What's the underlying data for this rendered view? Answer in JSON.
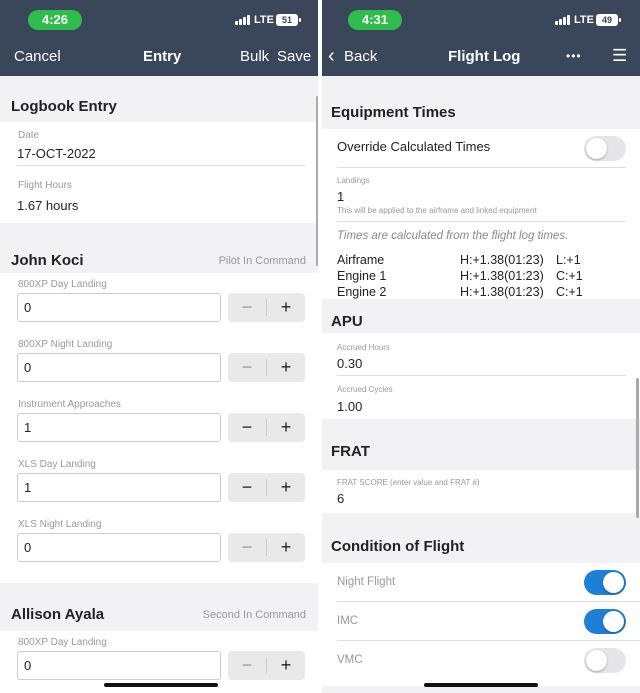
{
  "left": {
    "status": {
      "time": "4:26",
      "network": "LTE",
      "battery": "51"
    },
    "nav": {
      "cancel": "Cancel",
      "title": "Entry",
      "bulk": "Bulk",
      "save": "Save"
    },
    "section_title": "Logbook Entry",
    "date": {
      "label": "Date",
      "value": "17-OCT-2022"
    },
    "hours": {
      "label": "Flight Hours",
      "value": "1.67 hours"
    },
    "crew": [
      {
        "name": "John Koci",
        "role": "Pilot In Command",
        "fields": [
          {
            "label": "800XP Day Landing",
            "value": "0",
            "minus_enabled": false
          },
          {
            "label": "800XP Night Landing",
            "value": "0",
            "minus_enabled": false
          },
          {
            "label": "Instrument Approaches",
            "value": "1",
            "minus_enabled": true
          },
          {
            "label": "XLS Day Landing",
            "value": "1",
            "minus_enabled": true
          },
          {
            "label": "XLS Night Landing",
            "value": "0",
            "minus_enabled": false
          }
        ]
      },
      {
        "name": "Allison Ayala",
        "role": "Second In Command",
        "fields": [
          {
            "label": "800XP Day Landing",
            "value": "0",
            "minus_enabled": false
          }
        ]
      }
    ],
    "minus_symbol": "−",
    "plus_symbol": "+"
  },
  "right": {
    "status": {
      "time": "4:31",
      "network": "LTE",
      "battery": "49"
    },
    "nav": {
      "back": "Back",
      "title": "Flight Log",
      "more": "•••",
      "menu": "☰"
    },
    "equipment": {
      "title": "Equipment Times",
      "override_label": "Override Calculated Times",
      "override_on": false,
      "landings_label": "Landings",
      "landings_value": "1",
      "landings_hint": "This will be applied to the airframe and linked equipment",
      "calc_note": "Times are calculated from the flight log times.",
      "rows": [
        {
          "name": "Airframe",
          "hours": "H:+1.38(01:23)",
          "extra": "L:+1"
        },
        {
          "name": "Engine 1",
          "hours": "H:+1.38(01:23)",
          "extra": "C:+1"
        },
        {
          "name": "Engine 2",
          "hours": "H:+1.38(01:23)",
          "extra": "C:+1"
        }
      ]
    },
    "apu": {
      "title": "APU",
      "hours_label": "Accrued Hours",
      "hours_value": "0.30",
      "cycles_label": "Accrued Cycles",
      "cycles_value": "1.00"
    },
    "frat": {
      "title": "FRAT",
      "score_label": "FRAT SCORE (enter value and FRAT #)",
      "score_value": "6"
    },
    "condition": {
      "title": "Condition of Flight",
      "items": [
        {
          "label": "Night Flight",
          "on": true
        },
        {
          "label": "IMC",
          "on": true
        },
        {
          "label": "VMC",
          "on": false
        }
      ]
    }
  }
}
